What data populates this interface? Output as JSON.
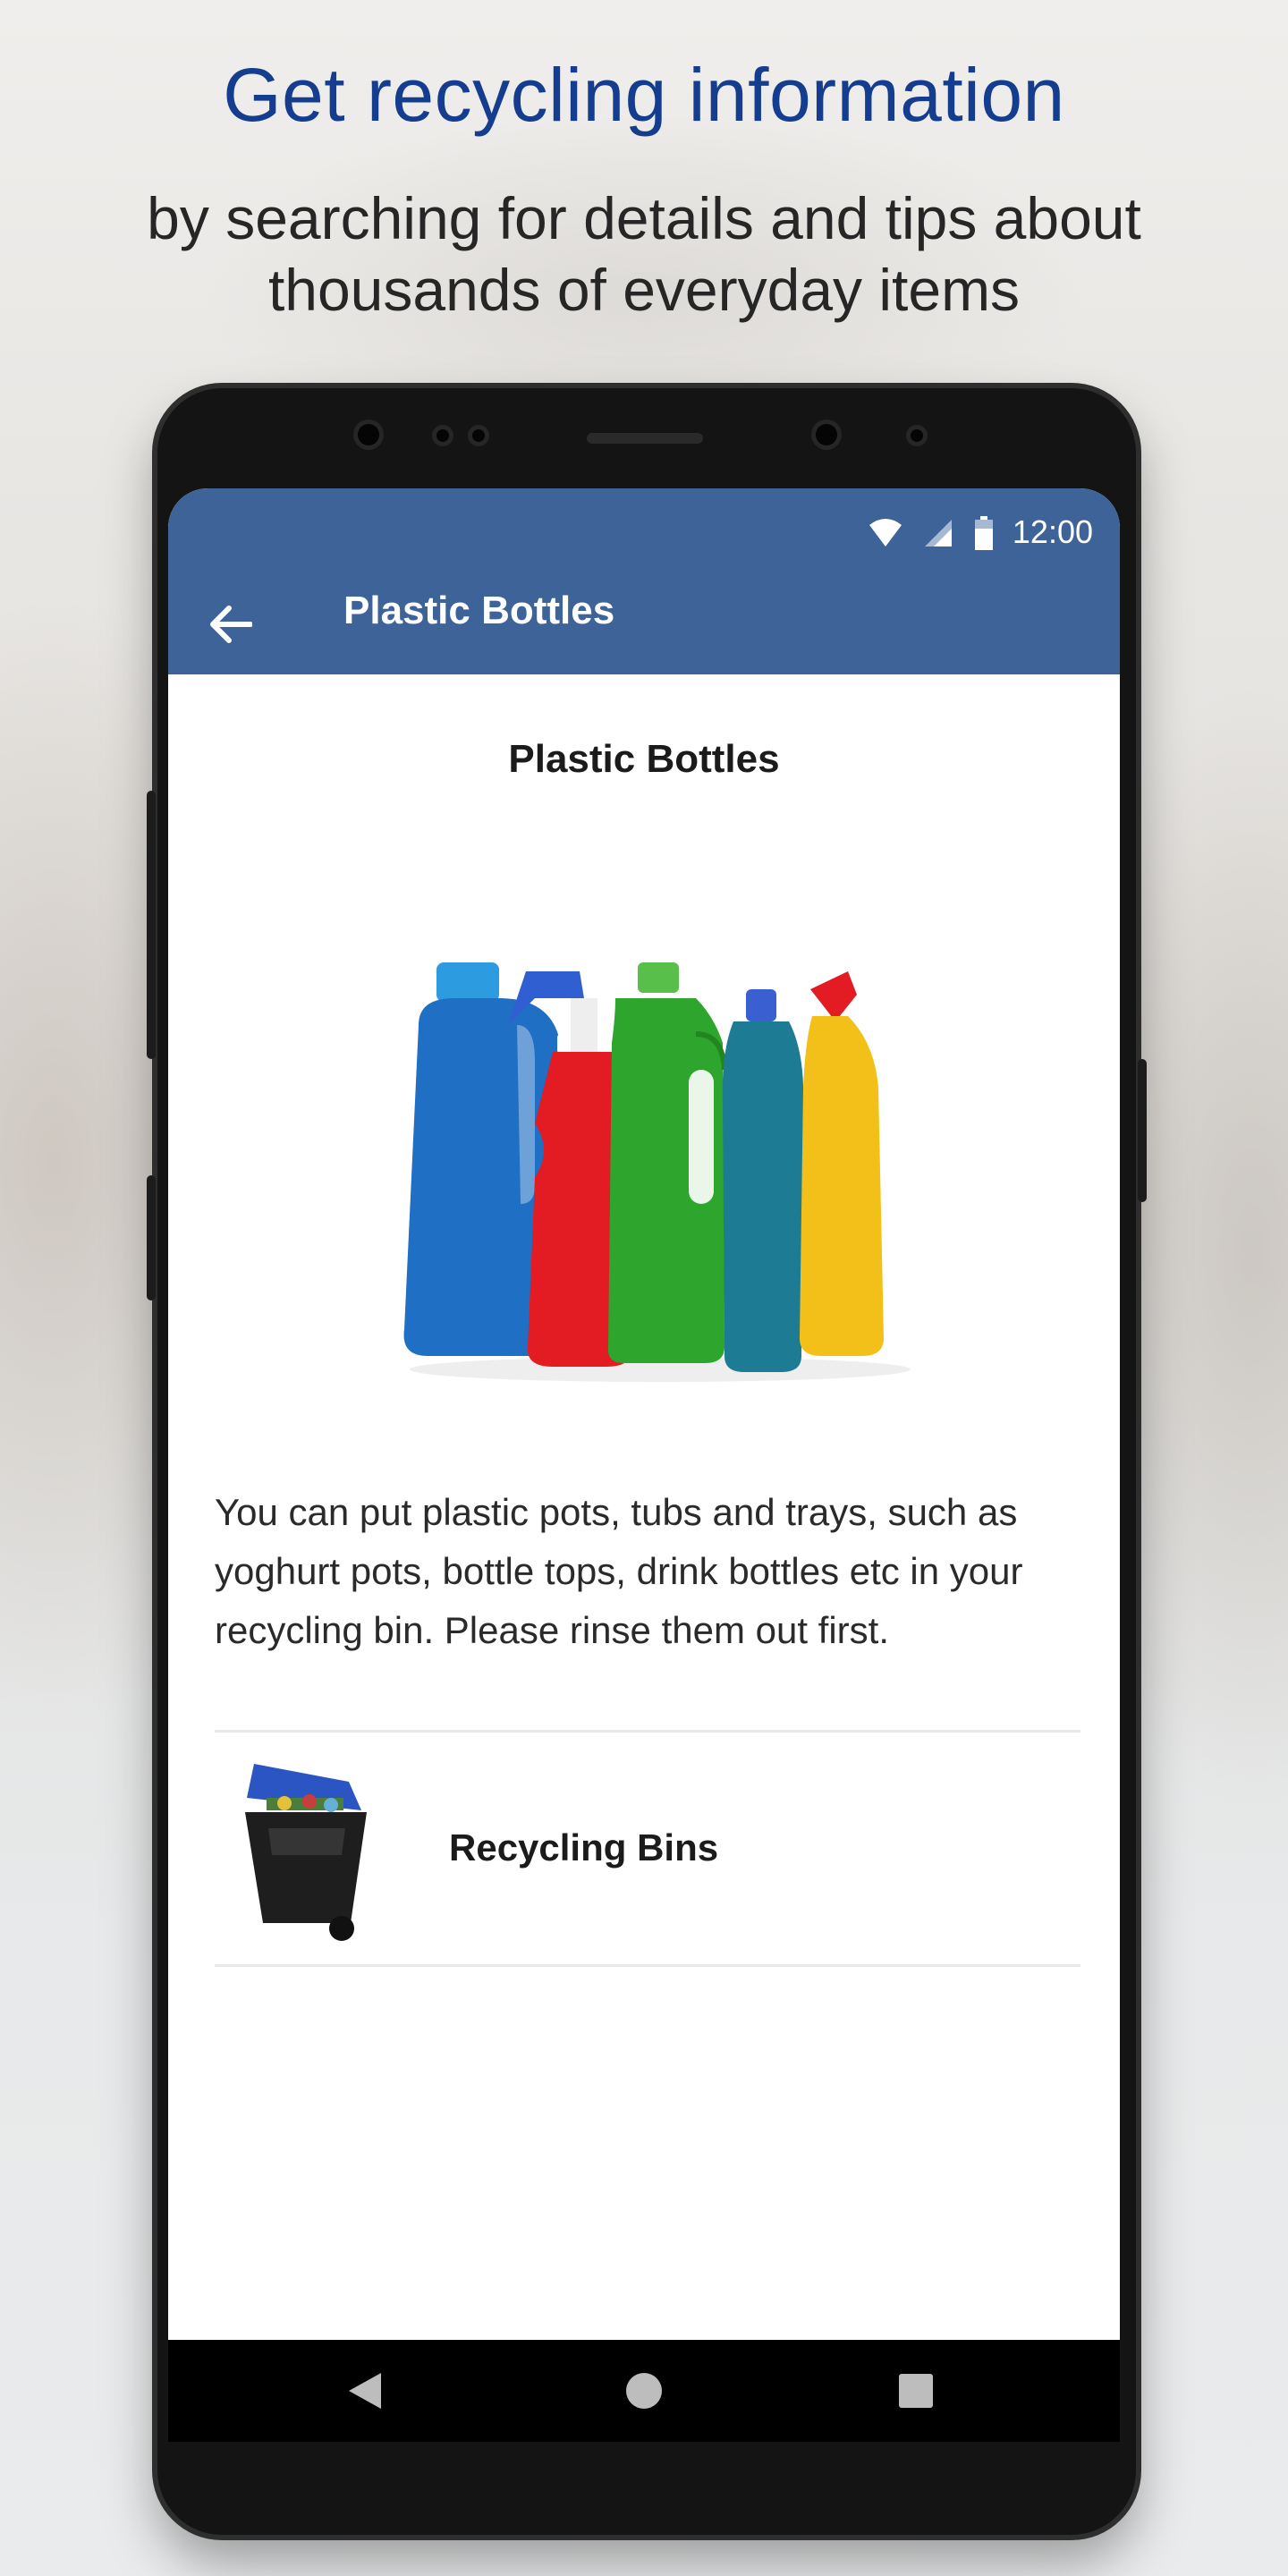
{
  "promo": {
    "headline": "Get recycling information",
    "subline_1": "by searching for details and tips about",
    "subline_2": "thousands of everyday items",
    "headline_color": "#143d8f"
  },
  "status_bar": {
    "time": "12:00",
    "icons": [
      "wifi-icon",
      "signal-icon",
      "battery-icon"
    ]
  },
  "app_bar": {
    "title": "Plastic Bottles",
    "back_icon": "arrow-back-icon",
    "color": "#3d6399"
  },
  "item": {
    "title": "Plastic Bottles",
    "image_icon": "plastic-bottles-image",
    "description": "You can put plastic pots, tubs and trays, such as yoghurt pots, bottle tops, drink bottles etc in your recycling bin.  Please rinse them out first."
  },
  "bins": [
    {
      "label": "Recycling Bins",
      "icon": "recycling-bin-icon"
    }
  ],
  "nav_bar": {
    "icons": [
      "back-triangle-icon",
      "home-circle-icon",
      "recents-square-icon"
    ]
  }
}
